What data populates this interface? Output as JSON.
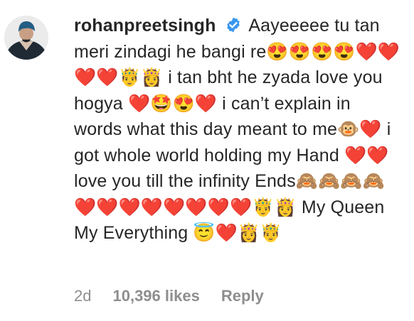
{
  "comment": {
    "username": "rohanpreetsingh",
    "verified_icon": "verified-badge-icon",
    "avatar_icon": "profile-avatar",
    "text": "Aayeeeee tu tan meri zindagi he bangi re😍😍😍😍❤️❤️❤️❤️🤴👸 i tan bht he zyada love you hogya ❤️🤩😍❤️ i can’t explain in words what this day meant to me🐵❤️ i got whole world holding my Hand ❤️❤️ love you till the infinity Ends🙈🙈🙈🙈❤️❤️❤️❤️❤️❤️❤️❤️🤴👸 My Queen My Everything 😇❤️👸🤴",
    "time": "2d",
    "likes": "10,396 likes",
    "reply_label": "Reply"
  },
  "colors": {
    "text": "#262626",
    "meta": "#8e8e8e",
    "verified": "#3897f0"
  }
}
